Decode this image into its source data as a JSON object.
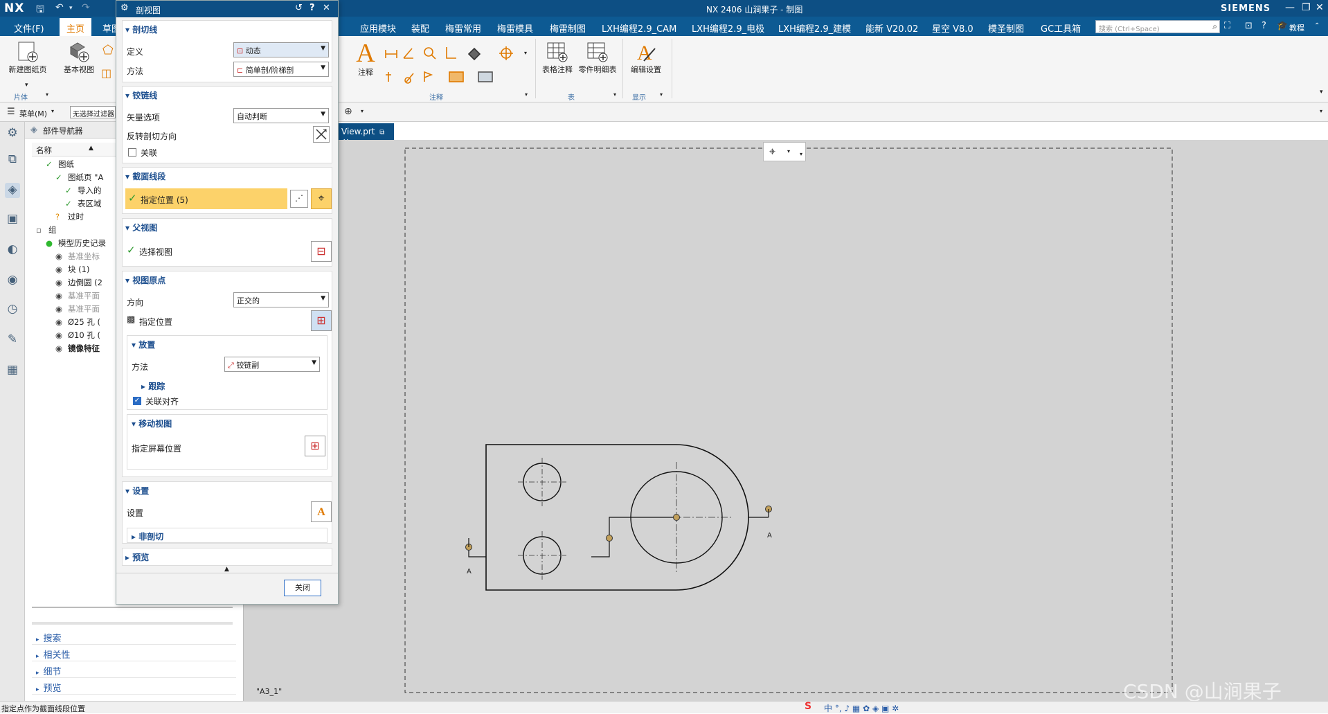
{
  "titlebar": {
    "logo": "NX",
    "title": "NX 2406  山涧果子 - 制图",
    "brand": "SIEMENS"
  },
  "menubar": {
    "items": [
      "文件(F)",
      "主页",
      "草图",
      "应用模块",
      "装配",
      "梅雷常用",
      "梅雷模具",
      "梅雷制图",
      "LXH编程2.9_CAM",
      "LXH编程2.9_电极",
      "LXH编程2.9_建模",
      "能新 V20.02",
      "星空 V8.0",
      "模圣制图",
      "GC工具箱"
    ],
    "search_placeholder": "搜索 (Ctrl+Space)",
    "tutorial": "教程"
  },
  "ribbon": {
    "new_sheet": "新建图纸页",
    "base_view": "基本视图",
    "group_sheet": "片体",
    "annotation": "注释",
    "group_annotation": "注释",
    "table_note": "表格注释",
    "parts_list": "零件明细表",
    "group_table": "表",
    "edit_settings": "编辑设置",
    "group_display": "显示"
  },
  "selbar": {
    "menu_label": "菜单(M)",
    "filter_placeholder": "无选择过滤器"
  },
  "navigator": {
    "title": "部件导航器",
    "col_name": "名称",
    "tree": [
      {
        "label": "图纸",
        "indent": 1,
        "state": "check",
        "gray": false,
        "bold": false
      },
      {
        "label": "图纸页 \"A",
        "indent": 2,
        "state": "check",
        "gray": false,
        "bold": false
      },
      {
        "label": "导入的",
        "indent": 3,
        "state": "check",
        "gray": false,
        "bold": false
      },
      {
        "label": "表区域",
        "indent": 3,
        "state": "check",
        "gray": false,
        "bold": false
      },
      {
        "label": "过时",
        "indent": 2,
        "state": "question",
        "gray": false,
        "bold": false
      },
      {
        "label": "组",
        "indent": 0,
        "state": "none",
        "gray": false,
        "bold": false
      },
      {
        "label": "模型历史记录",
        "indent": 1,
        "state": "green",
        "gray": false,
        "bold": false
      },
      {
        "label": "基准坐标",
        "indent": 2,
        "state": "eye",
        "gray": true,
        "bold": false
      },
      {
        "label": "块 (1)",
        "indent": 2,
        "state": "eye",
        "gray": false,
        "bold": false
      },
      {
        "label": "边倒圆 (2",
        "indent": 2,
        "state": "eye",
        "gray": false,
        "bold": false
      },
      {
        "label": "基准平面",
        "indent": 2,
        "state": "eye",
        "gray": true,
        "bold": false
      },
      {
        "label": "基准平面",
        "indent": 2,
        "state": "eye",
        "gray": true,
        "bold": false
      },
      {
        "label": "Ø25 孔 (",
        "indent": 2,
        "state": "eye",
        "gray": false,
        "bold": false
      },
      {
        "label": "Ø10 孔 (",
        "indent": 2,
        "state": "eye",
        "gray": false,
        "bold": false
      },
      {
        "label": "镜像特征",
        "indent": 2,
        "state": "eye",
        "gray": false,
        "bold": true
      }
    ],
    "sections": [
      "搜索",
      "相关性",
      "细节",
      "预览"
    ]
  },
  "dialog": {
    "title": "剖视图",
    "sec_cutline": "剖切线",
    "definition_label": "定义",
    "definition_value": "动态",
    "method_label": "方法",
    "method_value": "简单剖/阶梯剖",
    "sec_hinge": "铰链线",
    "vector_label": "矢量选项",
    "vector_value": "自动判断",
    "reverse_label": "反转剖切方向",
    "associative_label": "关联",
    "sec_segment": "截面线段",
    "specify_location": "指定位置 (5)",
    "sec_parent": "父视图",
    "select_view": "选择视图",
    "sec_origin": "视图原点",
    "direction_label": "方向",
    "direction_value": "正交的",
    "origin_specify": "指定位置",
    "sub_placement": "放置",
    "placement_method_label": "方法",
    "placement_method_value": "铰链副",
    "sub_track": "跟踪",
    "align_label": "关联对齐",
    "sub_move": "移动视图",
    "screen_position": "指定屏幕位置",
    "sec_settings": "设置",
    "settings_label": "设置",
    "sub_noncut": "非剖切",
    "sec_preview": "预览",
    "close_button": "关闭"
  },
  "doctab": {
    "label": "View.prt"
  },
  "canvas": {
    "sheet_name": "\"A3_1\"",
    "section_left": "A",
    "section_right": "A",
    "watermark": "CSDN @山涧果子"
  },
  "statusbar": {
    "message": "指定点作为截面线段位置"
  },
  "colors": {
    "titlebar": "#0d4f84",
    "menubar": "#0d5a93",
    "accent": "#e07a00",
    "highlight": "#fcd26a",
    "canvas": "#d3d3d3"
  }
}
